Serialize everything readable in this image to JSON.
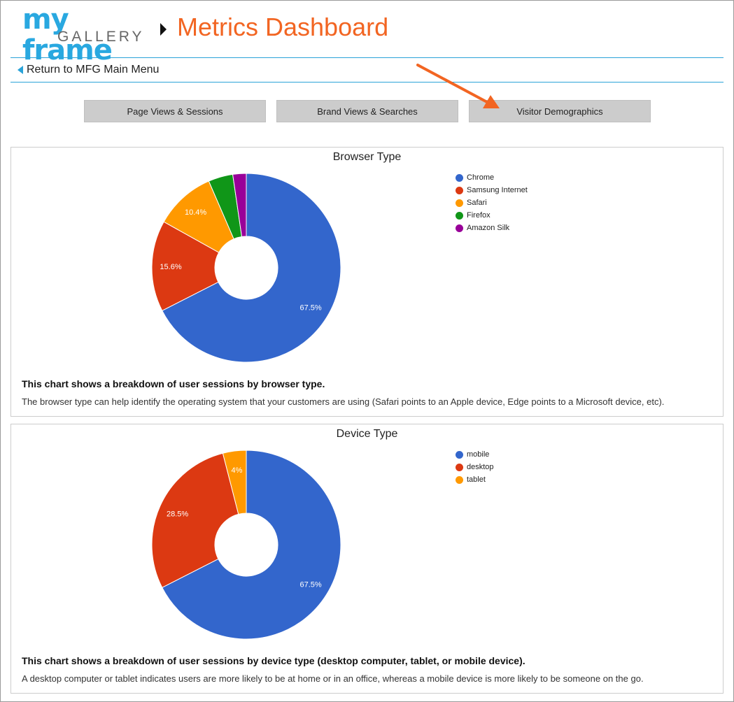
{
  "header": {
    "logo_top": "my frame",
    "logo_bottom": "GALLERY",
    "page_title": "Metrics Dashboard",
    "back_label": "Return to MFG Main Menu"
  },
  "nav": {
    "tabs": [
      {
        "label": "Page Views & Sessions"
      },
      {
        "label": "Brand Views & Searches"
      },
      {
        "label": "Visitor Demographics"
      }
    ]
  },
  "colors": {
    "accent": "#f26522",
    "rule": "#2aa3d8",
    "logo_blue": "#29a8e0"
  },
  "chart_data": [
    {
      "type": "pie",
      "donut": true,
      "title": "Browser Type",
      "legend_position": "right",
      "categories": [
        "Chrome",
        "Samsung Internet",
        "Safari",
        "Firefox",
        "Amazon Silk"
      ],
      "values": [
        67.5,
        15.6,
        10.4,
        4.2,
        2.3
      ],
      "labels": [
        "67.5%",
        "15.6%",
        "10.4%",
        "",
        ""
      ],
      "colors": [
        "#3366cc",
        "#dc3912",
        "#ff9900",
        "#109618",
        "#990099"
      ]
    },
    {
      "type": "pie",
      "donut": true,
      "title": "Device Type",
      "legend_position": "right",
      "categories": [
        "mobile",
        "desktop",
        "tablet"
      ],
      "values": [
        67.5,
        28.5,
        4
      ],
      "labels": [
        "67.5%",
        "28.5%",
        "4%"
      ],
      "colors": [
        "#3366cc",
        "#dc3912",
        "#ff9900"
      ]
    }
  ],
  "panels": [
    {
      "desc_head": "This chart shows a breakdown of user sessions by browser type.",
      "desc_body": "The browser type can help identify the operating system that your customers are using (Safari points to an Apple device, Edge points to a Microsoft device, etc)."
    },
    {
      "desc_head": "This chart shows a breakdown of user sessions by device type (desktop computer, tablet, or mobile device).",
      "desc_body": "A desktop computer or tablet indicates users are more likely to be at home or in an office, whereas a mobile device is more likely to be someone on the go."
    }
  ]
}
